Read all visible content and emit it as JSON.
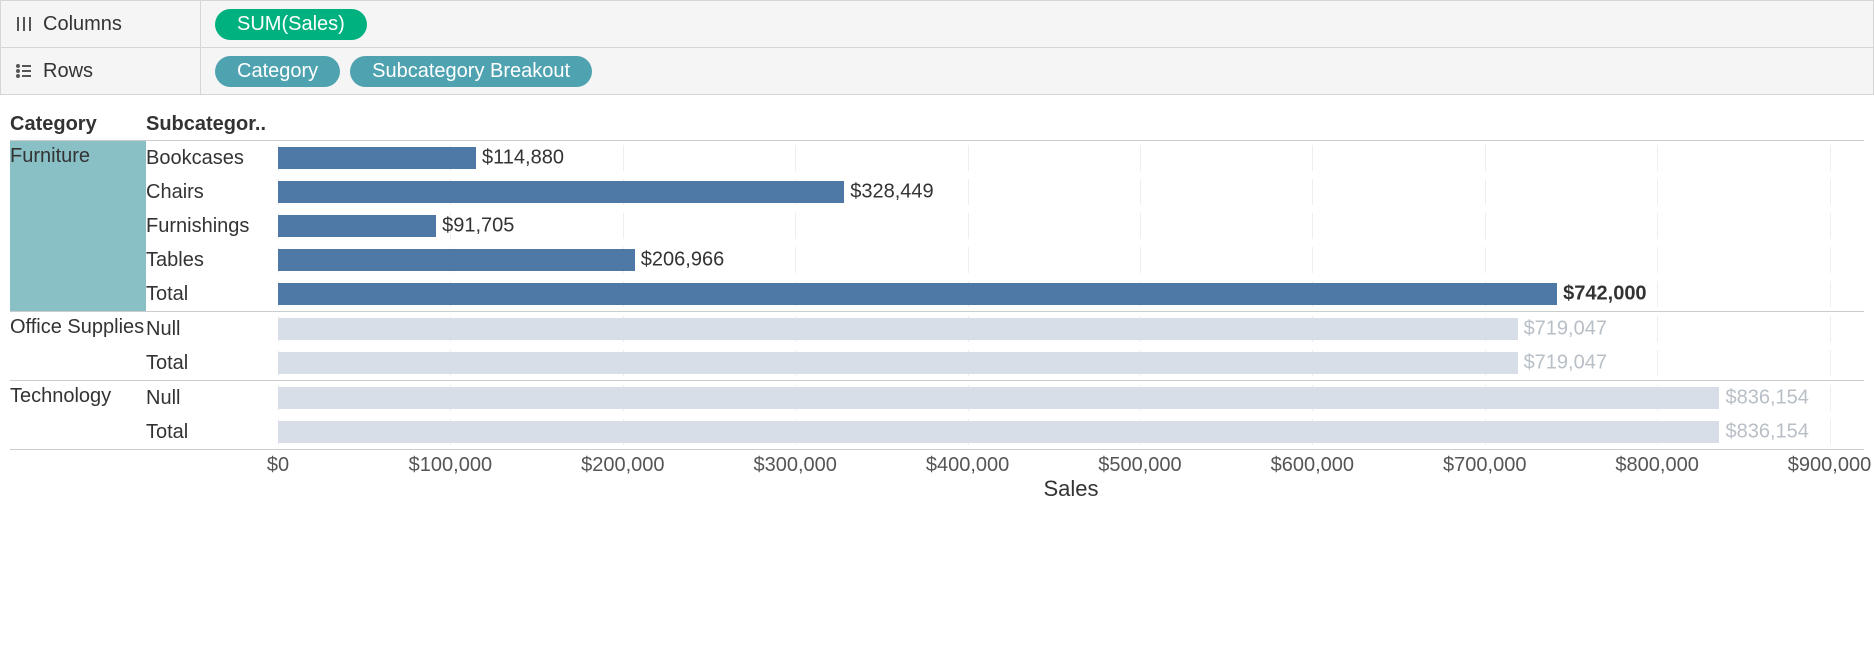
{
  "shelves": {
    "columns_label": "Columns",
    "rows_label": "Rows",
    "columns_pills": [
      {
        "text": "SUM(Sales)",
        "style": "pill-green",
        "name": "pill-sum-sales"
      }
    ],
    "rows_pills": [
      {
        "text": "Category",
        "style": "pill-teal",
        "name": "pill-category"
      },
      {
        "text": "Subcategory Breakout",
        "style": "pill-teal",
        "name": "pill-subcategory-breakout"
      }
    ]
  },
  "headers": {
    "category": "Category",
    "subcategory": "Subcategor.."
  },
  "axis": {
    "title": "Sales",
    "max": 920000,
    "ticks": [
      {
        "v": 0,
        "l": "$0"
      },
      {
        "v": 100000,
        "l": "$100,000"
      },
      {
        "v": 200000,
        "l": "$200,000"
      },
      {
        "v": 300000,
        "l": "$300,000"
      },
      {
        "v": 400000,
        "l": "$400,000"
      },
      {
        "v": 500000,
        "l": "$500,000"
      },
      {
        "v": 600000,
        "l": "$600,000"
      },
      {
        "v": 700000,
        "l": "$700,000"
      },
      {
        "v": 800000,
        "l": "$800,000"
      },
      {
        "v": 900000,
        "l": "$900,000"
      }
    ]
  },
  "groups": [
    {
      "category": "Furniture",
      "selected": true,
      "rows": [
        {
          "sub": "Bookcases",
          "value": 114880,
          "label": "$114,880",
          "bold": false
        },
        {
          "sub": "Chairs",
          "value": 328449,
          "label": "$328,449",
          "bold": false
        },
        {
          "sub": "Furnishings",
          "value": 91705,
          "label": "$91,705",
          "bold": false
        },
        {
          "sub": "Tables",
          "value": 206966,
          "label": "$206,966",
          "bold": false
        },
        {
          "sub": "Total",
          "value": 742000,
          "label": "$742,000",
          "bold": true
        }
      ]
    },
    {
      "category": "Office Supplies",
      "selected": false,
      "rows": [
        {
          "sub": "Null",
          "value": 719047,
          "label": "$719,047",
          "bold": false
        },
        {
          "sub": "Total",
          "value": 719047,
          "label": "$719,047",
          "bold": false
        }
      ]
    },
    {
      "category": "Technology",
      "selected": false,
      "rows": [
        {
          "sub": "Null",
          "value": 836154,
          "label": "$836,154",
          "bold": false
        },
        {
          "sub": "Total",
          "value": 836154,
          "label": "$836,154",
          "bold": false
        }
      ]
    }
  ],
  "chart_data": {
    "type": "bar",
    "orientation": "horizontal",
    "xlabel": "Sales",
    "xlim": [
      0,
      920000
    ],
    "series": [
      {
        "category": "Furniture",
        "subcategory": "Bookcases",
        "value": 114880
      },
      {
        "category": "Furniture",
        "subcategory": "Chairs",
        "value": 328449
      },
      {
        "category": "Furniture",
        "subcategory": "Furnishings",
        "value": 91705
      },
      {
        "category": "Furniture",
        "subcategory": "Tables",
        "value": 206966
      },
      {
        "category": "Furniture",
        "subcategory": "Total",
        "value": 742000
      },
      {
        "category": "Office Supplies",
        "subcategory": "Null",
        "value": 719047
      },
      {
        "category": "Office Supplies",
        "subcategory": "Total",
        "value": 719047
      },
      {
        "category": "Technology",
        "subcategory": "Null",
        "value": 836154
      },
      {
        "category": "Technology",
        "subcategory": "Total",
        "value": 836154
      }
    ],
    "highlight": "Furniture"
  }
}
